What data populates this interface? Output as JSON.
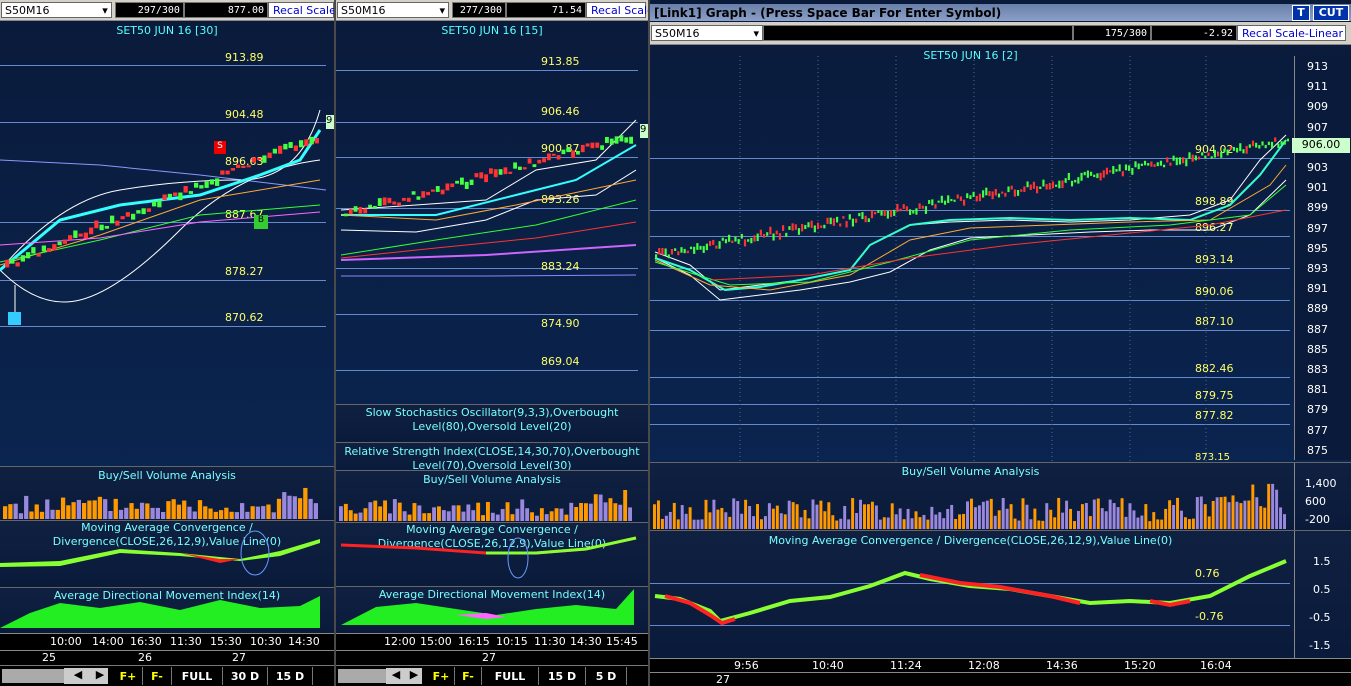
{
  "panel1": {
    "symbol": "S50M16",
    "counter": "297/300",
    "value": "877.00",
    "recal": "Recal Scale",
    "title": "SET50 JUN 16  [30]",
    "levels": [
      "913.89",
      "904.48",
      "896.63",
      "887.67",
      "878.27",
      "870.62"
    ],
    "price_tag": "9",
    "signal_s": "S",
    "signal_b": "B",
    "vol_title": "Buy/Sell Volume Analysis",
    "macd_title": "Moving Average Convergence / Divergence(CLOSE,26,12,9),Value Line(0)",
    "adx_title": "Average Directional Movement Index(14)",
    "times": [
      "10:00",
      "14:00",
      "16:30",
      "11:30",
      "15:30",
      "10:30",
      "14:30"
    ],
    "dates": [
      "25",
      "26",
      "27"
    ],
    "buttons": [
      "F+",
      "F-",
      "FULL",
      "30 D",
      "15 D"
    ]
  },
  "panel2": {
    "symbol": "S50M16",
    "counter": "277/300",
    "value": "71.54",
    "recal": "Recal Scale",
    "title": "SET50 JUN 16  [15]",
    "levels": [
      "913.85",
      "906.46",
      "900.87",
      "893.26",
      "883.24",
      "874.90",
      "869.04"
    ],
    "price_tag": "9",
    "stoch_title": "Slow Stochastics Oscillator(9,3,3),Overbought Level(80),Oversold Level(20)",
    "rsi_title": "Relative Strength Index(CLOSE,14,30,70),Overbought Level(70),Oversold Level(30)",
    "vol_title": "Buy/Sell Volume Analysis",
    "macd_title": "Moving Average Convergence / Divergence(CLOSE,26,12,9),Value Line(0)",
    "adx_title": "Average Directional Movement Index(14)",
    "times": [
      "12:00",
      "15:00",
      "16:15",
      "10:15",
      "11:30",
      "14:30",
      "15:45"
    ],
    "dates": [
      "27"
    ],
    "buttons": [
      "F+",
      "F-",
      "FULL",
      "15 D",
      "5 D"
    ]
  },
  "panel3": {
    "window_title": "[Link1] Graph  - (Press Space Bar For Enter Symbol)",
    "btn_t": "T",
    "btn_cut": "CUT",
    "symbol": "S50M16",
    "counter": "175/300",
    "value": "-2.92",
    "recal": "Recal Scale-Linear",
    "title": "SET50 JUN 16  [2]",
    "levels": [
      "904.02",
      "898.89",
      "896.27",
      "893.14",
      "890.06",
      "887.10",
      "882.46",
      "879.75",
      "877.82",
      "873.15"
    ],
    "price_tag": "906.00",
    "price_axis": [
      "913",
      "911",
      "909",
      "907",
      "905",
      "903",
      "901",
      "899",
      "897",
      "895",
      "893",
      "891",
      "889",
      "887",
      "885",
      "883",
      "881",
      "879",
      "877",
      "875"
    ],
    "vol_title": "Buy/Sell Volume Analysis",
    "vol_axis": [
      "1,400",
      "600",
      "-200"
    ],
    "macd_title": "Moving Average Convergence / Divergence(CLOSE,26,12,9),Value Line(0)",
    "macd_levels": [
      "0.76",
      "-0.76"
    ],
    "macd_axis": [
      "1.5",
      "0.5",
      "-0.5",
      "-1.5"
    ],
    "times": [
      "9:56",
      "10:40",
      "11:24",
      "12:08",
      "14:36",
      "15:20",
      "16:04"
    ],
    "dates": [
      "27"
    ]
  },
  "colors": {
    "level": "#ffff66",
    "title": "#55ffff",
    "up": "#88ff33",
    "down": "#ff2222",
    "vol_orange": "#ff9900",
    "vol_purple": "#9988dd"
  }
}
